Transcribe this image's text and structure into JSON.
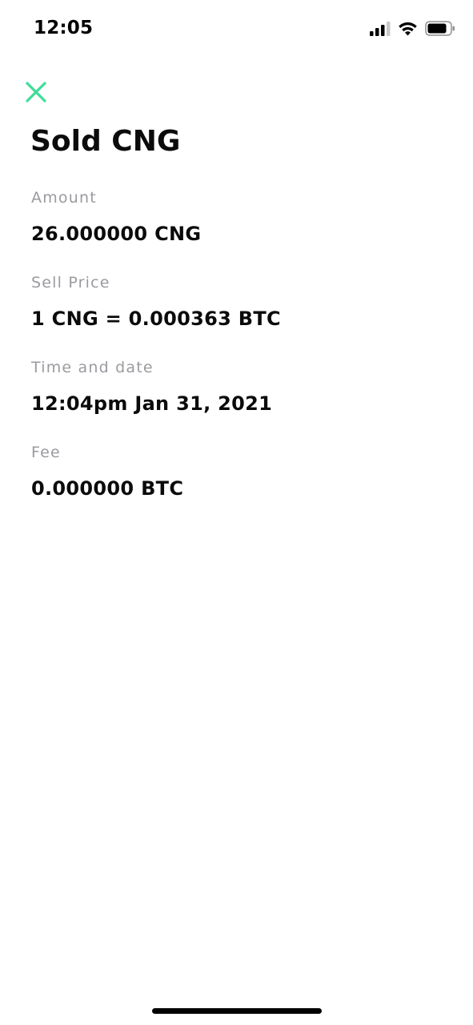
{
  "status_bar": {
    "time": "12:05",
    "icons": [
      "signal-icon",
      "wifi-icon",
      "battery-icon"
    ]
  },
  "header": {
    "close_icon": "close-icon",
    "close_color": "#3ddc97",
    "title": "Sold CNG"
  },
  "details": {
    "amount": {
      "label": "Amount",
      "value": "26.000000 CNG"
    },
    "sell_price": {
      "label": "Sell Price",
      "value": "1 CNG = 0.000363 BTC"
    },
    "time_date": {
      "label": "Time and date",
      "value": "12:04pm Jan 31, 2021"
    },
    "fee": {
      "label": "Fee",
      "value": "0.000000 BTC"
    }
  },
  "colors": {
    "accent": "#3ddc97",
    "label": "#9a9aa0",
    "text": "#0b0b0b"
  }
}
